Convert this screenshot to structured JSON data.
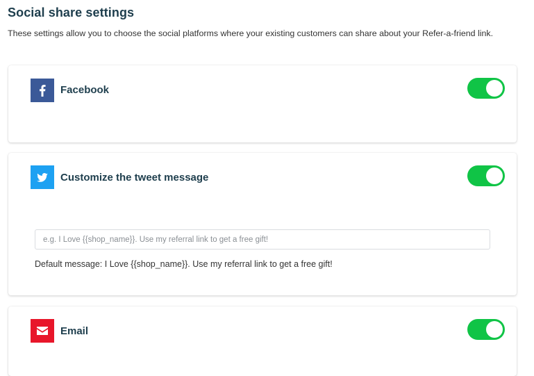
{
  "header": {
    "title": "Social share settings",
    "subtitle": "These settings allow you to choose the social platforms where your existing customers can share about your Refer-a-friend link."
  },
  "platforms": {
    "facebook": {
      "label": "Facebook",
      "icon": "facebook-icon",
      "color": "#3b5998",
      "enabled": true
    },
    "twitter": {
      "label": "Customize the tweet message",
      "icon": "twitter-icon",
      "color": "#1da1f2",
      "enabled": true,
      "input_value": "",
      "input_placeholder": "e.g. I Love {{shop_name}}. Use my referral link to get a free gift!",
      "default_message": "Default message: I Love {{shop_name}}. Use my referral link to get a free gift!"
    },
    "email": {
      "label": "Email",
      "icon": "envelope-icon",
      "color": "#e8162a",
      "enabled": true
    }
  },
  "colors": {
    "toggle_on": "#10c446",
    "heading": "#1e3e4d"
  }
}
